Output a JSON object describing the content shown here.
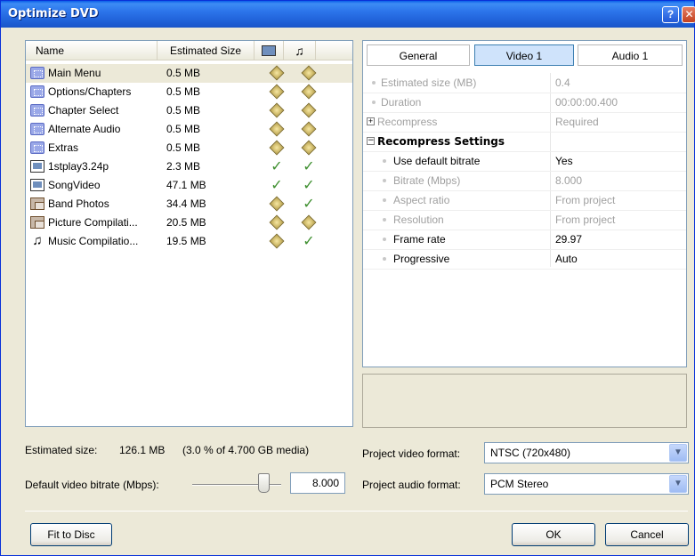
{
  "window": {
    "title": "Optimize DVD"
  },
  "list": {
    "headers": {
      "name": "Name",
      "size": "Estimated Size"
    },
    "items": [
      {
        "name": "Main Menu",
        "size": "0.5 MB",
        "icon": "menu",
        "video": "warn",
        "audio": "warn",
        "selected": true
      },
      {
        "name": "Options/Chapters",
        "size": "0.5 MB",
        "icon": "menu",
        "video": "warn",
        "audio": "warn"
      },
      {
        "name": "Chapter Select",
        "size": "0.5 MB",
        "icon": "menu",
        "video": "warn",
        "audio": "warn"
      },
      {
        "name": "Alternate Audio",
        "size": "0.5 MB",
        "icon": "menu",
        "video": "warn",
        "audio": "warn"
      },
      {
        "name": "Extras",
        "size": "0.5 MB",
        "icon": "menu",
        "video": "warn",
        "audio": "warn"
      },
      {
        "name": "1stplay3.24p",
        "size": "2.3 MB",
        "icon": "video",
        "video": "ok",
        "audio": "ok"
      },
      {
        "name": "SongVideo",
        "size": "47.1 MB",
        "icon": "video",
        "video": "ok",
        "audio": "ok"
      },
      {
        "name": "Band Photos",
        "size": "34.4 MB",
        "icon": "photos",
        "video": "warn",
        "audio": "ok"
      },
      {
        "name": "Picture Compilati...",
        "size": "20.5 MB",
        "icon": "photos",
        "video": "warn",
        "audio": "warn"
      },
      {
        "name": "Music Compilatio...",
        "size": "19.5 MB",
        "icon": "music",
        "video": "warn",
        "audio": "ok"
      }
    ]
  },
  "tabs": [
    {
      "label": "General",
      "active": false
    },
    {
      "label": "Video 1",
      "active": true
    },
    {
      "label": "Audio 1",
      "active": false
    }
  ],
  "properties": {
    "estimated_size": {
      "name": "Estimated size (MB)",
      "value": "0.4"
    },
    "duration": {
      "name": "Duration",
      "value": "00:00:00.400"
    },
    "recompress": {
      "name": "Recompress",
      "value": "Required"
    },
    "section": "Recompress Settings",
    "use_default_bitrate": {
      "name": "Use default bitrate",
      "value": "Yes"
    },
    "bitrate": {
      "name": "Bitrate (Mbps)",
      "value": "8.000"
    },
    "aspect_ratio": {
      "name": "Aspect ratio",
      "value": "From project"
    },
    "resolution": {
      "name": "Resolution",
      "value": "From project"
    },
    "frame_rate": {
      "name": "Frame rate",
      "value": "29.97"
    },
    "progressive": {
      "name": "Progressive",
      "value": "Auto"
    }
  },
  "footer": {
    "estimated_label": "Estimated size:",
    "estimated_value": "126.1 MB",
    "estimated_pct": "(3.0 % of 4.700 GB media)",
    "bitrate_label": "Default video bitrate (Mbps):",
    "bitrate_value": "8.000",
    "video_format_label": "Project video format:",
    "video_format_value": "NTSC (720x480)",
    "audio_format_label": "Project audio format:",
    "audio_format_value": "PCM Stereo"
  },
  "buttons": {
    "fit": "Fit to Disc",
    "ok": "OK",
    "cancel": "Cancel"
  },
  "titlebar_buttons": {
    "help": "?"
  }
}
